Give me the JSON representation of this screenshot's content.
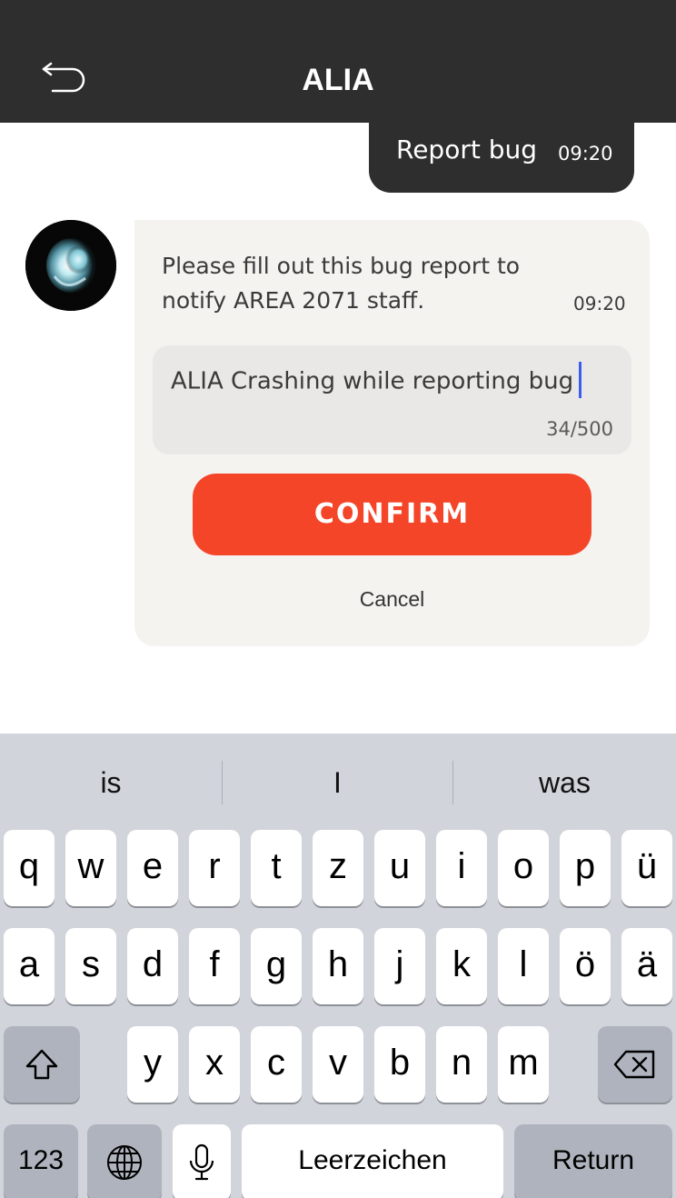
{
  "header": {
    "title": "ALIA",
    "back_icon": "back-arrow-icon"
  },
  "user_message": {
    "text": "Report bug",
    "time": "09:20"
  },
  "bot_message": {
    "avatar_icon": "alia-orb-avatar",
    "text": "Please fill out this bug report to notify AREA 2071 staff.",
    "time": "09:20"
  },
  "bug_report": {
    "input_value": "ALIA Crashing while reporting bug",
    "char_count": "34/500",
    "confirm_label": "CONFIRM",
    "cancel_label": "Cancel"
  },
  "keyboard": {
    "suggestions": [
      "is",
      "I",
      "was"
    ],
    "row1": [
      "q",
      "w",
      "e",
      "r",
      "t",
      "z",
      "u",
      "i",
      "o",
      "p",
      "ü"
    ],
    "row2": [
      "a",
      "s",
      "d",
      "f",
      "g",
      "h",
      "j",
      "k",
      "l",
      "ö",
      "ä"
    ],
    "row3": [
      "y",
      "x",
      "c",
      "v",
      "b",
      "n",
      "m"
    ],
    "numbers_label": "123",
    "space_label": "Leerzeichen",
    "return_label": "Return",
    "shift_icon": "shift-icon",
    "delete_icon": "delete-icon",
    "globe_icon": "globe-icon",
    "mic_icon": "microphone-icon"
  },
  "colors": {
    "header_bg": "#2e2e2e",
    "confirm_bg": "#f44528",
    "card_bg": "#f5f3f0",
    "caret": "#3b5cf0",
    "keyboard_bg": "#d1d4da"
  }
}
